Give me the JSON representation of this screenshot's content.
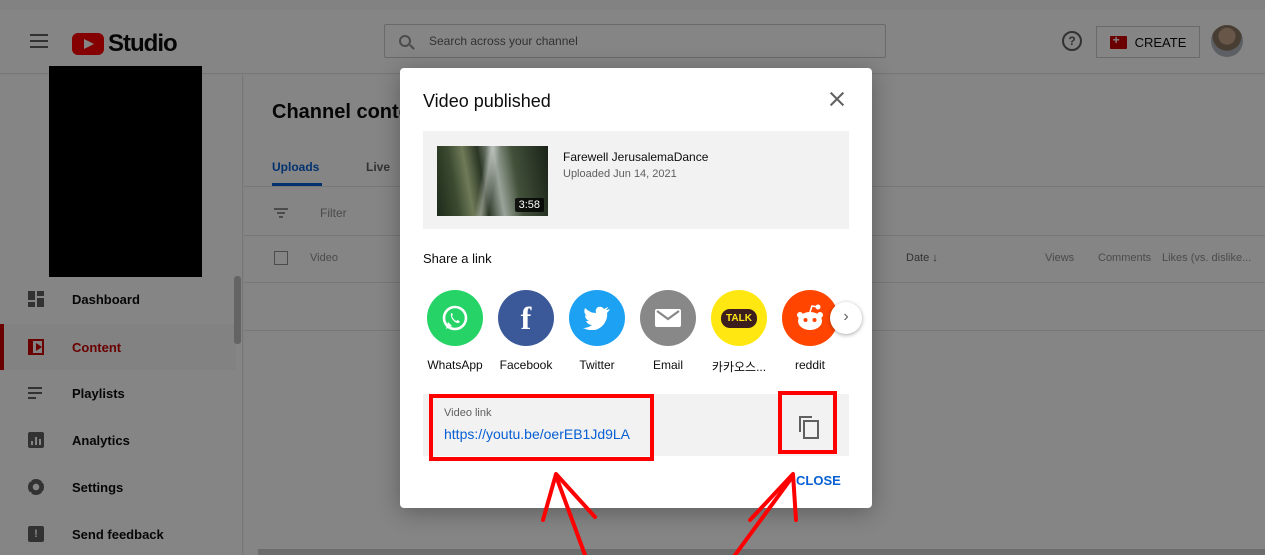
{
  "topbar": {
    "logo_text": "Studio",
    "search_placeholder": "Search across your channel",
    "help_glyph": "?",
    "create_label": "CREATE"
  },
  "sidebar": {
    "items": [
      {
        "label": "Dashboard",
        "icon": "dashboard-icon"
      },
      {
        "label": "Content",
        "icon": "content-icon",
        "active": true
      },
      {
        "label": "Playlists",
        "icon": "playlists-icon"
      },
      {
        "label": "Analytics",
        "icon": "analytics-icon"
      },
      {
        "label": "Settings",
        "icon": "settings-icon"
      },
      {
        "label": "Send feedback",
        "icon": "feedback-icon"
      }
    ]
  },
  "main": {
    "title": "Channel content",
    "tabs": [
      {
        "label": "Uploads",
        "active": true
      },
      {
        "label": "Live"
      }
    ],
    "filter_label": "Filter",
    "columns": {
      "video": "Video",
      "date": "Date ↓",
      "views": "Views",
      "comments": "Comments",
      "likes": "Likes (vs. dislike..."
    }
  },
  "dialog": {
    "title": "Video published",
    "video": {
      "title": "Farewell JerusalemaDance",
      "uploaded": "Uploaded Jun 14, 2021",
      "duration": "3:58"
    },
    "share_label": "Share a link",
    "share_targets": [
      {
        "name": "WhatsApp",
        "color": "#25d366",
        "icon": "whatsapp-icon"
      },
      {
        "name": "Facebook",
        "color": "#3b5998",
        "icon": "facebook-icon"
      },
      {
        "name": "Twitter",
        "color": "#1da1f2",
        "icon": "twitter-icon"
      },
      {
        "name": "Email",
        "color": "#888888",
        "icon": "email-icon"
      },
      {
        "name": "카카오스...",
        "color": "#ffe812",
        "icon": "kakaotalk-icon",
        "badge": "TALK"
      },
      {
        "name": "reddit",
        "color": "#ff4500",
        "icon": "reddit-icon"
      }
    ],
    "link_label": "Video link",
    "link_url": "https://youtu.be/oerEB1Jd9LA",
    "close_label": "CLOSE"
  },
  "colors": {
    "accent_blue": "#065fd4",
    "brand_red": "#ff0000",
    "annotation_red": "#ff0000"
  }
}
